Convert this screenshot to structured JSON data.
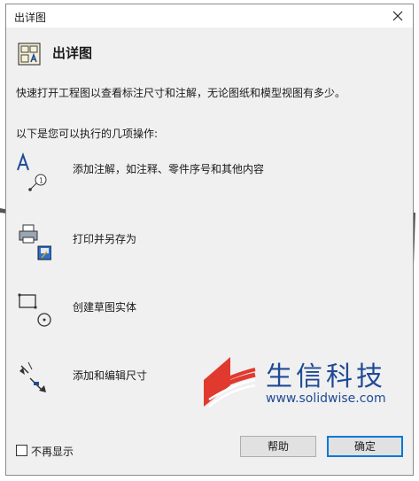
{
  "window": {
    "title": "出详图"
  },
  "header": {
    "title": "出详图",
    "icon": "drawing-sheet-icon"
  },
  "description": "快速打开工程图以查看标注尺寸和注解，无论图纸和模型视图有多少。",
  "subheading": "以下是您可以执行的几项操作:",
  "options": [
    {
      "label": "添加注解，如注释、零件序号和其他内容",
      "icon": "annotation-icon"
    },
    {
      "label": "打印并另存为",
      "icon": "print-save-icon"
    },
    {
      "label": "创建草图实体",
      "icon": "sketch-entity-icon"
    },
    {
      "label": "添加和编辑尺寸",
      "icon": "dimension-icon"
    }
  ],
  "footer": {
    "dont_show_label": "不再显示",
    "dont_show_checked": false,
    "help_label": "帮助",
    "ok_label": "确定"
  },
  "watermark": {
    "brand": "生信科技",
    "url": "www.solidwise.com"
  },
  "colors": {
    "accent": "#0078d7",
    "brand_blue": "#1f4a96",
    "brand_red": "#e03a2f"
  }
}
